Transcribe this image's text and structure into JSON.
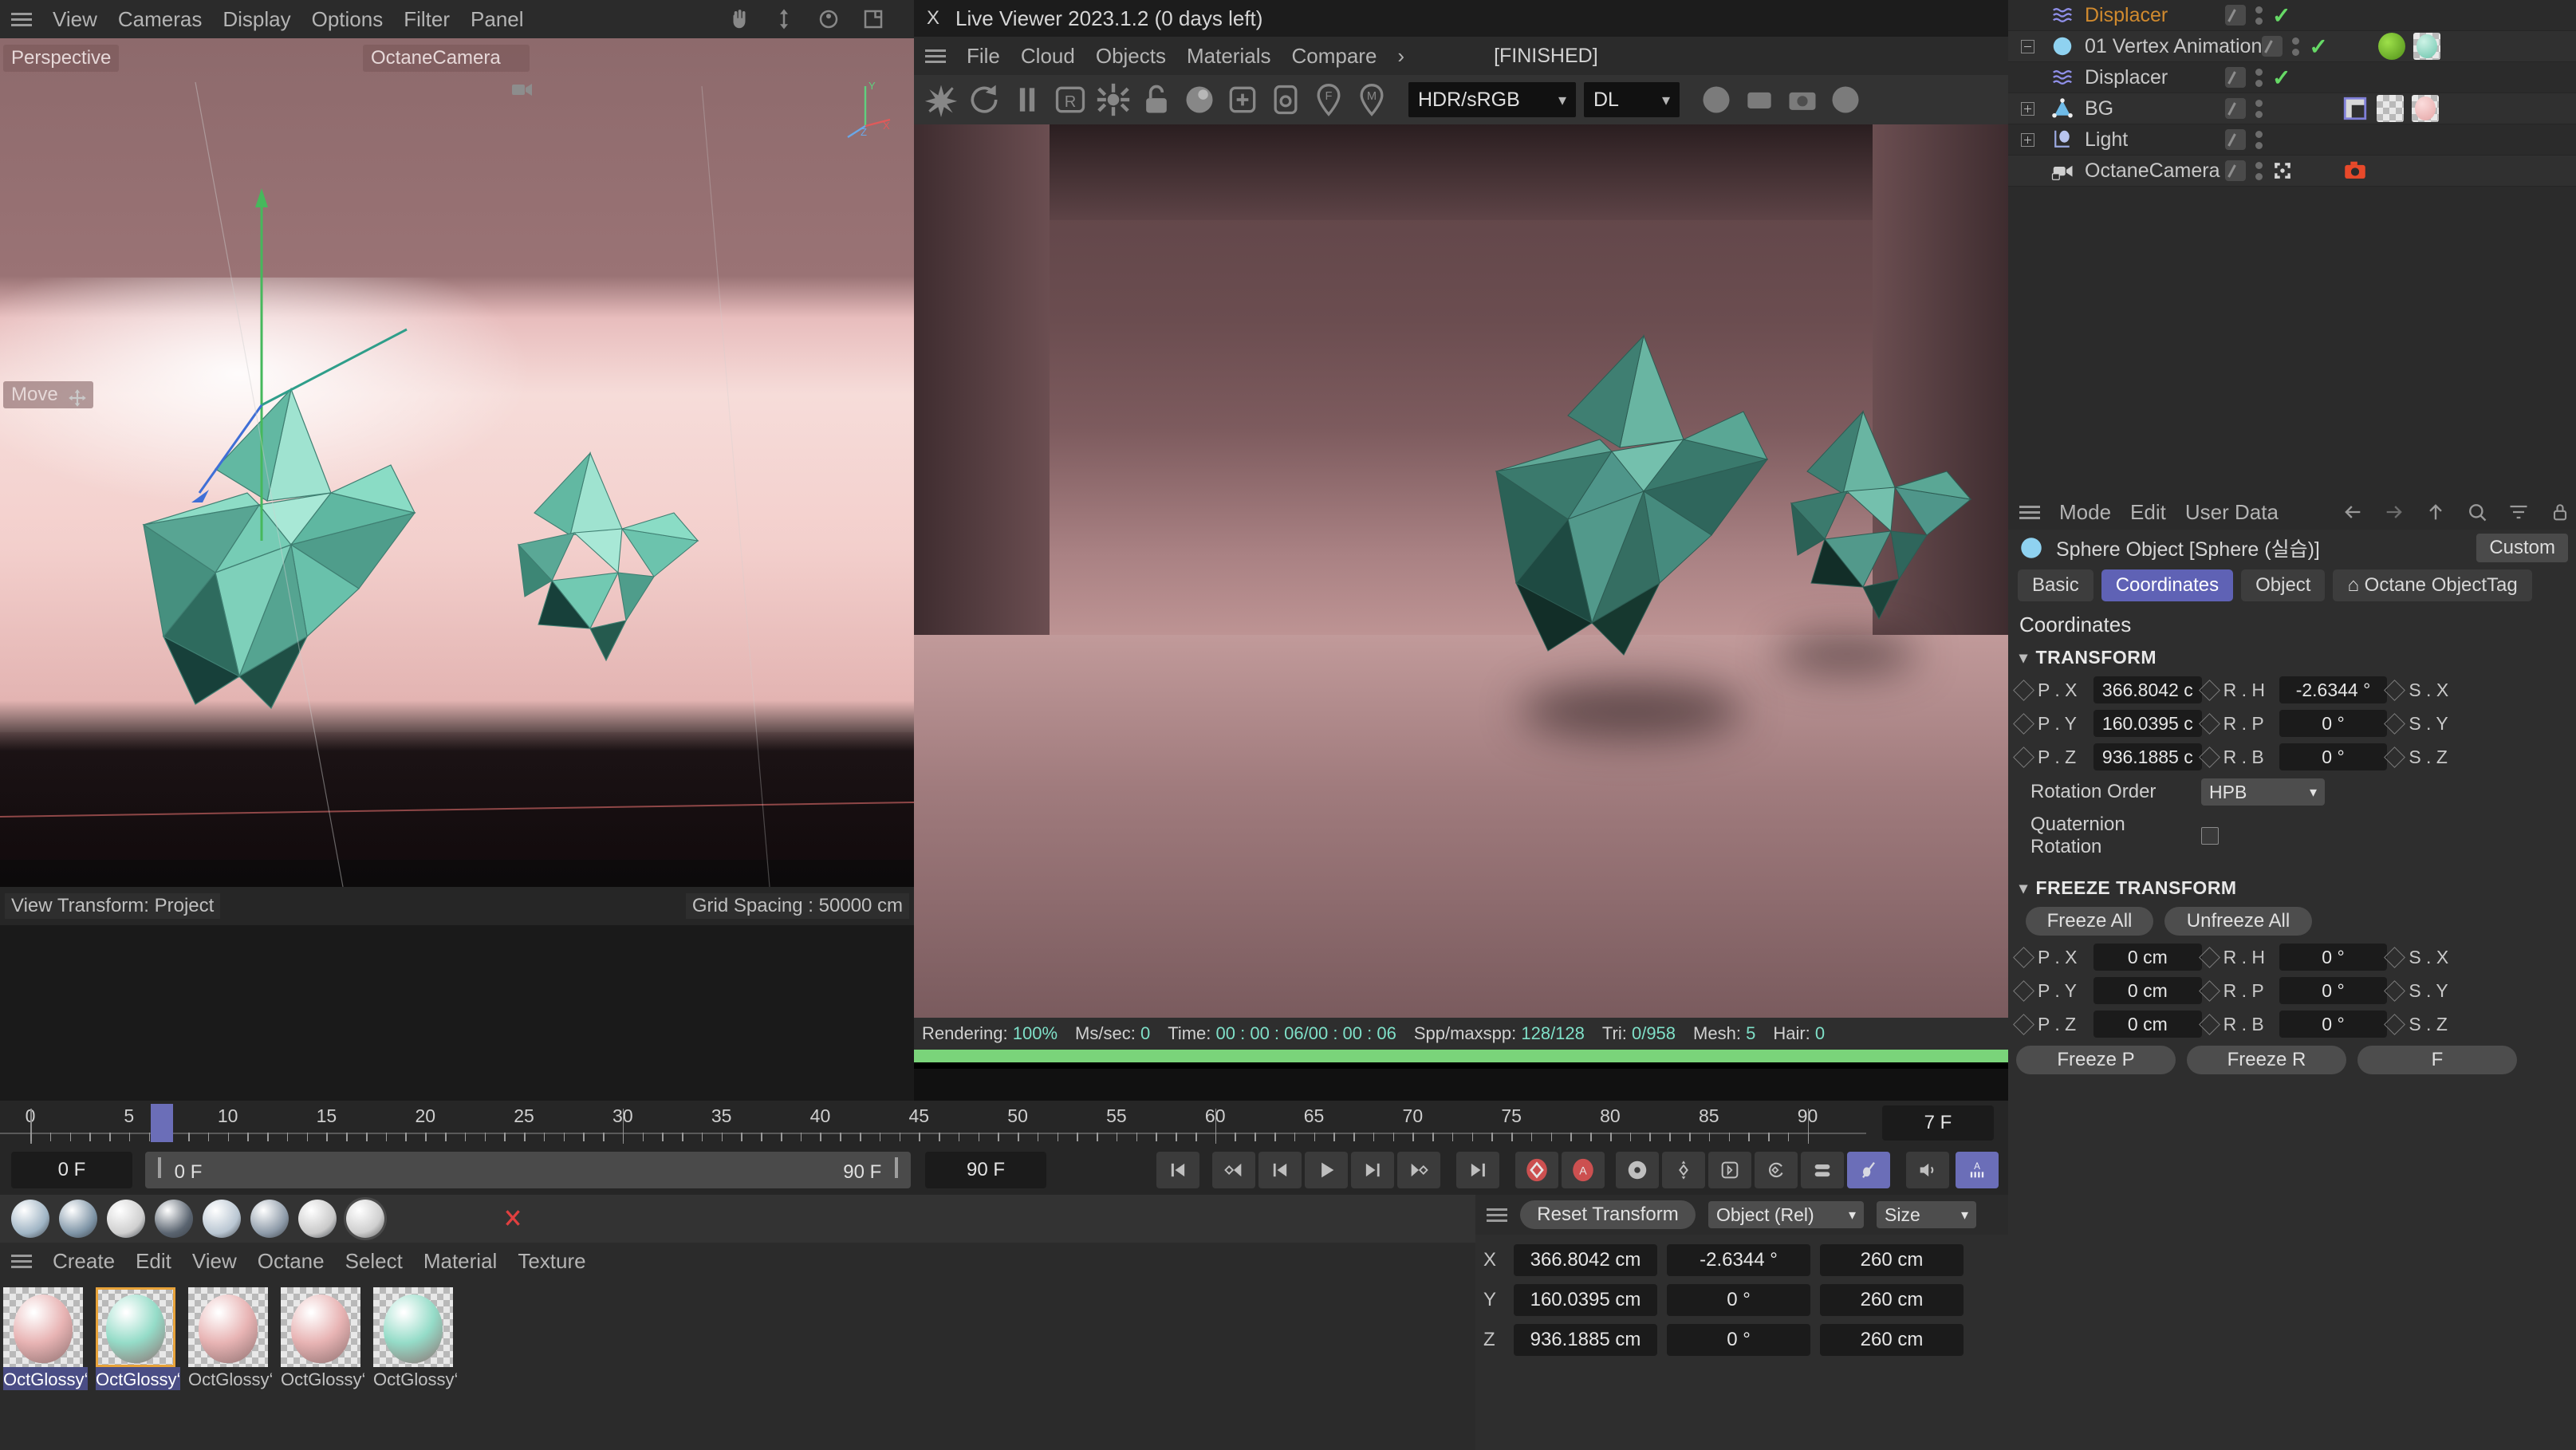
{
  "viewport": {
    "menus": [
      "View",
      "Cameras",
      "Display",
      "Options",
      "Filter",
      "Panel"
    ],
    "icons": [
      "hand-icon",
      "move-vertical-icon",
      "rotate-icon",
      "panel-icon"
    ],
    "perspective_label": "Perspective",
    "camera_label": "OctaneCamera",
    "tool_label": "Move",
    "view_transform": "View Transform: Project",
    "grid_spacing": "Grid Spacing : 50000 cm",
    "axis_labels": {
      "x": "X",
      "y": "Y",
      "z": "Z"
    }
  },
  "live_viewer": {
    "close_label": "X",
    "title": "Live Viewer 2023.1.2 (0 days left)",
    "menus": [
      "File",
      "Cloud",
      "Objects",
      "Materials",
      "Compare"
    ],
    "menu_more": "›",
    "status_badge": "[FINISHED]",
    "toolbar_icons": [
      "stop-render-icon",
      "restart-render-icon",
      "pause-icon",
      "region-render-icon",
      "settings-gear-icon",
      "lock-icon",
      "material-sphere-icon",
      "add-object-icon",
      "object-picker-icon",
      "focus-picker-icon",
      "material-picker-icon"
    ],
    "toolbar_icons_right": [
      "sphere-preview-icon",
      "square-preview-icon",
      "camera-icon",
      "render-preview-icon"
    ],
    "colorspace": "HDR/sRGB",
    "kernel": "DL",
    "status": {
      "rendering_label": "Rendering:",
      "rendering_value": "100%",
      "mssec_label": "Ms/sec:",
      "mssec_value": "0",
      "time_label": "Time:",
      "time_value": "00 : 00 : 06/00 : 00 : 06",
      "spp_label": "Spp/maxspp:",
      "spp_value": "128/128",
      "tri_label": "Tri:",
      "tri_value": "0/958",
      "mesh_label": "Mesh:",
      "mesh_value": "5",
      "hair_label": "Hair:",
      "hair_value": "0"
    },
    "progress_percent": 100
  },
  "object_manager": {
    "rows": [
      {
        "name": "Displacer",
        "type": "tag",
        "icon": "displacer-icon",
        "indent": 2,
        "expand": "none",
        "visible_check": true,
        "tags": []
      },
      {
        "name": "01 Vertex Animation",
        "type": "object",
        "icon": "sphere-object-icon",
        "indent": 1,
        "expand": "minus",
        "visible_check": true,
        "tags": [
          "green-dot-tag",
          "teal-material-tag"
        ]
      },
      {
        "name": "Displacer",
        "type": "tag-plain",
        "icon": "displacer-icon",
        "indent": 2,
        "expand": "none",
        "visible_check": true,
        "tags": []
      },
      {
        "name": "BG",
        "type": "object",
        "icon": "null-object-icon",
        "indent": 1,
        "expand": "plus",
        "visible_check": false,
        "tags": [
          "corner-pin-tag",
          "checker-tag",
          "pink-material-tag"
        ]
      },
      {
        "name": "Light",
        "type": "object",
        "icon": "light-object-icon",
        "indent": 1,
        "expand": "plus",
        "visible_check": false,
        "tags": []
      },
      {
        "name": "OctaneCamera",
        "type": "object",
        "icon": "camera-object-icon",
        "indent": 1,
        "expand": "none",
        "visible_check": false,
        "tags": [
          "octane-camera-tag"
        ]
      }
    ]
  },
  "attribute_manager": {
    "menus": [
      "Mode",
      "Edit",
      "User Data"
    ],
    "nav_icons": [
      "back-arrow-icon",
      "forward-arrow-icon",
      "up-arrow-icon",
      "search-icon",
      "filter-icon",
      "lock-icon"
    ],
    "object_title": "Sphere Object [Sphere (실습)]",
    "layout_button": "Custom",
    "tabs": [
      {
        "label": "Basic",
        "active": false
      },
      {
        "label": "Coordinates",
        "active": true
      },
      {
        "label": "Object",
        "active": false
      },
      {
        "label": "⌂ Octane ObjectTag",
        "active": false
      }
    ],
    "heading": "Coordinates",
    "transform": {
      "title": "TRANSFORM",
      "rows": [
        {
          "p_label": "P . X",
          "p_value": "366.8042 c",
          "r_label": "R . H",
          "r_value": "-2.6344 °",
          "s_label": "S . X"
        },
        {
          "p_label": "P . Y",
          "p_value": "160.0395 c",
          "r_label": "R . P",
          "r_value": "0 °",
          "s_label": "S . Y"
        },
        {
          "p_label": "P . Z",
          "p_value": "936.1885 c",
          "r_label": "R . B",
          "r_value": "0 °",
          "s_label": "S . Z"
        }
      ],
      "rotation_order_label": "Rotation Order",
      "rotation_order_value": "HPB",
      "quaternion_label": "Quaternion Rotation"
    },
    "freeze": {
      "title": "FREEZE TRANSFORM",
      "freeze_all": "Freeze All",
      "unfreeze_all": "Unfreeze All",
      "rows": [
        {
          "p_label": "P . X",
          "p_value": "0 cm",
          "r_label": "R . H",
          "r_value": "0 °",
          "s_label": "S . X"
        },
        {
          "p_label": "P . Y",
          "p_value": "0 cm",
          "r_label": "R . P",
          "r_value": "0 °",
          "s_label": "S . Y"
        },
        {
          "p_label": "P . Z",
          "p_value": "0 cm",
          "r_label": "R . B",
          "r_value": "0 °",
          "s_label": "S . Z"
        }
      ],
      "freeze_p": "Freeze P",
      "freeze_r": "Freeze R",
      "freeze_s": "F"
    }
  },
  "timeline": {
    "ticks": [
      0,
      5,
      10,
      15,
      20,
      25,
      30,
      35,
      40,
      45,
      50,
      55,
      60,
      65,
      70,
      75,
      80,
      85,
      90
    ],
    "max_frame": 90,
    "playhead_frame": 7,
    "playhead_label": "7",
    "current_frame_field": "7 F",
    "frame_start": "0 F",
    "range_start": "0 F",
    "range_end": "90 F",
    "frame_end": "90 F",
    "playback_icons": [
      "go-to-start-icon",
      "prev-keyframe-icon",
      "step-back-icon",
      "play-icon",
      "step-forward-icon",
      "next-keyframe-icon",
      "go-to-end-icon",
      "record-keyframe-icon",
      "autokey-icon",
      "keyframe-settings-icon",
      "record-position-icon",
      "record-scale-icon",
      "record-rotation-icon",
      "record-param-icon",
      "point-level-anim-icon",
      "sound-icon",
      "anim-mode-icon"
    ]
  },
  "material_manager": {
    "menus": [
      "Create",
      "Edit",
      "View",
      "Octane",
      "Select",
      "Material",
      "Texture"
    ],
    "sphere_icons": [
      "diffuse-sphere",
      "glossy-sphere",
      "specular-sphere",
      "mix-sphere-1",
      "mix-sphere-2",
      "portal-sphere",
      "toon-sphere",
      "universal-sphere"
    ],
    "materials": [
      {
        "name": "OctGlossy‘",
        "color": "#e8b4b4",
        "selected": false,
        "name_highlight": true
      },
      {
        "name": "OctGlossy‘",
        "color": "#95dcc8",
        "selected": true,
        "name_highlight": true
      },
      {
        "name": "OctGlossy‘",
        "color": "#e8b4b4",
        "selected": false,
        "name_highlight": false
      },
      {
        "name": "OctGlossy‘",
        "color": "#e8b4b4",
        "selected": false,
        "name_highlight": false
      },
      {
        "name": "OctGlossy‘",
        "color": "#95dcc8",
        "selected": false,
        "name_highlight": false
      }
    ]
  },
  "coordinate_manager": {
    "reset_button": "Reset Transform",
    "mode_dropdown": "Object (Rel)",
    "size_dropdown": "Size",
    "rows": [
      {
        "axis": "X",
        "position": "366.8042 cm",
        "rotation": "-2.6344 °",
        "size": "260 cm"
      },
      {
        "axis": "Y",
        "position": "160.0395 cm",
        "rotation": "0 °",
        "size": "260 cm"
      },
      {
        "axis": "Z",
        "position": "936.1885 cm",
        "rotation": "0 °",
        "size": "260 cm"
      }
    ]
  },
  "colors": {
    "accent_blue": "#5f62b5",
    "check_green": "#66d966",
    "tag_orange": "#d08a2e",
    "progress_green": "#7ad47a",
    "selection_orange": "#e8a33a",
    "crystal_teal": "#7fd4bd"
  }
}
